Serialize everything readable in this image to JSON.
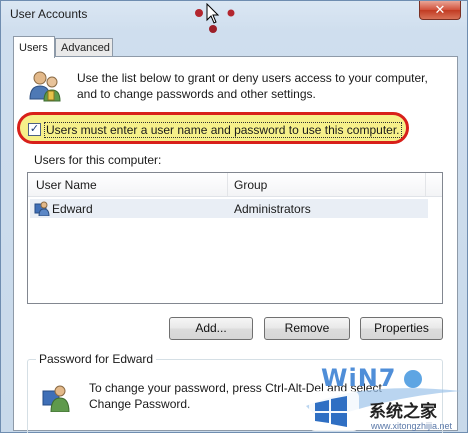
{
  "window": {
    "title": "User Accounts",
    "close_glyph": "✕"
  },
  "tabs": [
    {
      "label": "Users",
      "active": true
    },
    {
      "label": "Advanced",
      "active": false
    }
  ],
  "intro": {
    "text": "Use the list below to grant or deny users access to your computer, and to change passwords and other settings."
  },
  "require_login": {
    "label": "Users must enter a user name and password to use this computer.",
    "checked": true,
    "check_glyph": "✓"
  },
  "users_section": {
    "label": "Users for this computer:",
    "columns": [
      "User Name",
      "Group"
    ],
    "rows": [
      {
        "name": "Edward",
        "group": "Administrators"
      }
    ]
  },
  "buttons": {
    "add": "Add...",
    "remove": "Remove",
    "properties": "Properties"
  },
  "password_group": {
    "title": "Password for Edward",
    "text": "To change your password, press Ctrl-Alt-Del and select Change Password."
  },
  "watermark": {
    "win": "WiN7",
    "brand": "系统之家",
    "url": "www.xitongzhijia.net"
  },
  "icons": {
    "users": "users-icon",
    "user": "user-icon",
    "password": "password-user-icon"
  },
  "colors": {
    "highlight_ring": "#d8201a",
    "highlight_fill": "#f6f08a",
    "close": "#c13b22"
  }
}
